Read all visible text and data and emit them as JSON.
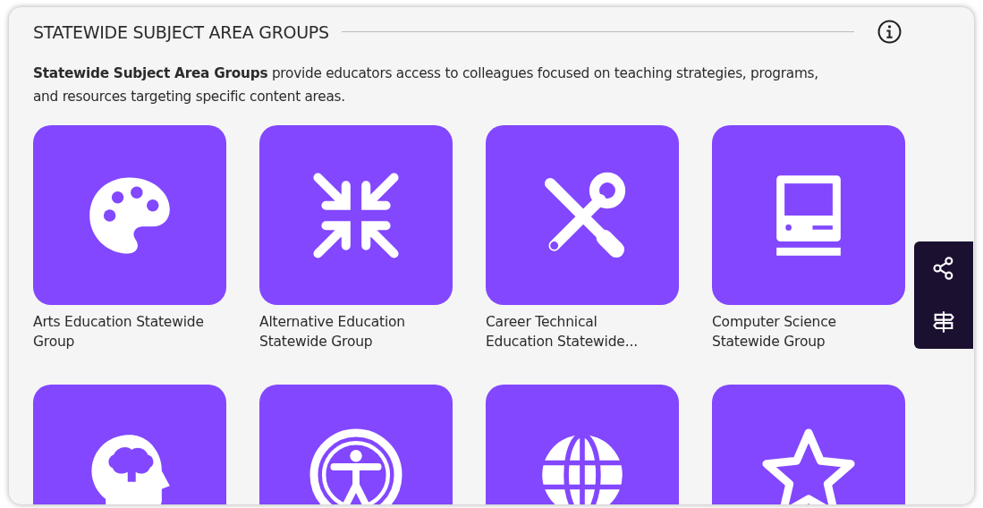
{
  "section": {
    "title": "STATEWIDE SUBJECT AREA GROUPS",
    "description": "**Statewide Subject Area Groups** provide educators access to colleagues focused on teaching strategies, programs, and resources targeting  specific content areas."
  },
  "groups": [
    {
      "title": "Arts Education Statewide Group",
      "cut_off": false
    },
    {
      "title": "Alternative Education Statewide Group",
      "cut_off": false
    },
    {
      "title": "Career Technical Education Statewide...",
      "cut_off": false
    },
    {
      "title": "Computer Science Statewide Group",
      "cut_off": false
    },
    {
      "cut_off": true
    },
    {
      "cut_off": true
    },
    {
      "cut_off": true
    },
    {
      "cut_off": true
    }
  ]
}
